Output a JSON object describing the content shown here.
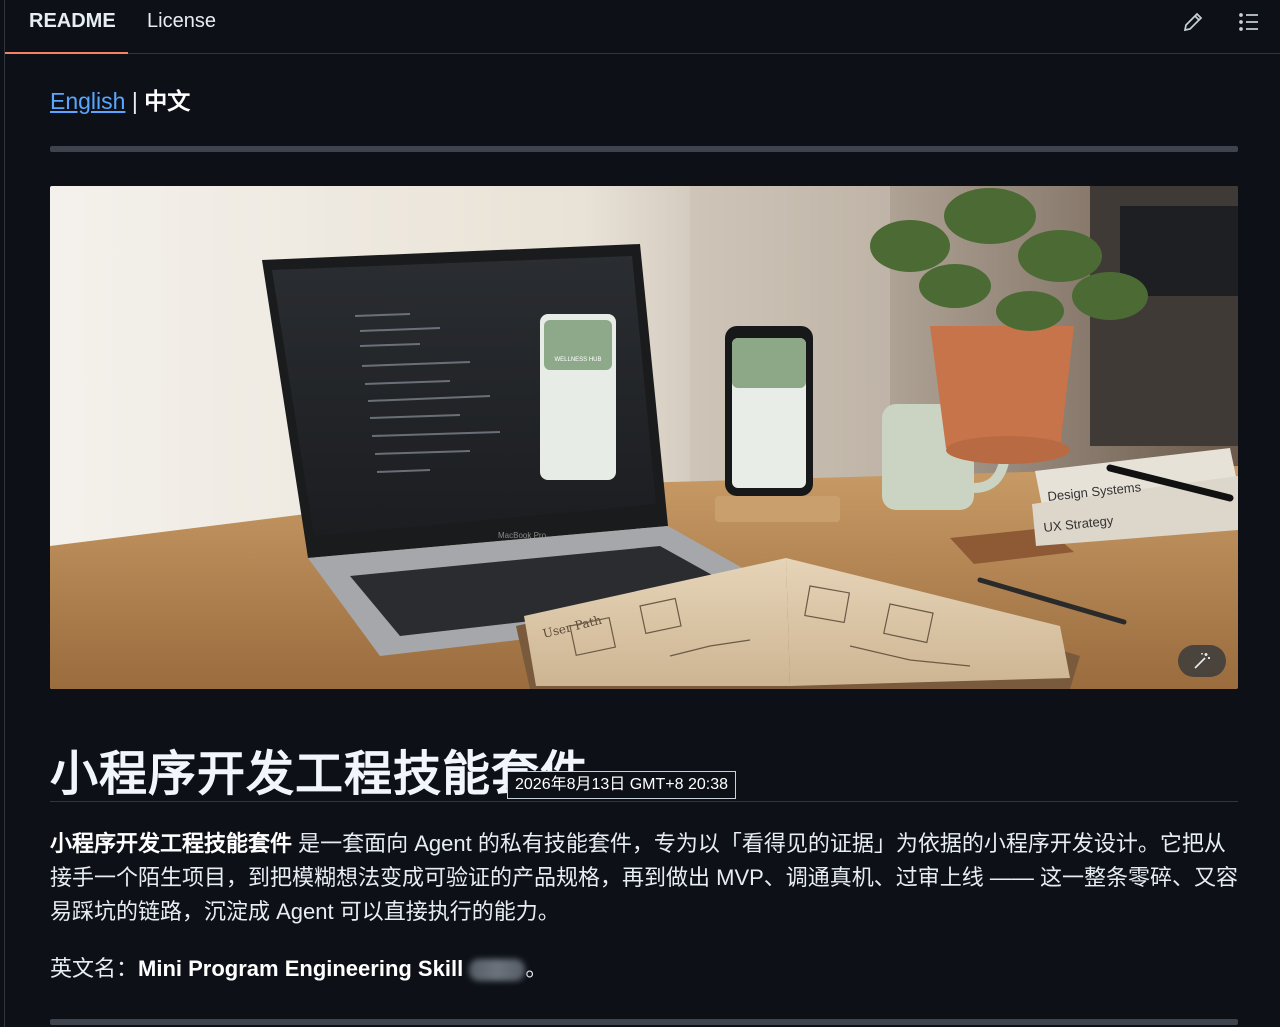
{
  "tabs": [
    {
      "label": "README",
      "active": true
    },
    {
      "label": "License",
      "active": false
    }
  ],
  "toolbar": {
    "edit_icon": "pencil-icon",
    "outline_icon": "list-outline-icon"
  },
  "language": {
    "english": "English",
    "separator": "|",
    "chinese": "中文"
  },
  "hero": {
    "alt_icon": "magic-wand-icon",
    "laptop_brand": "MacBook Pro",
    "app_screen_title": "WELLNESS HUB",
    "book_titles": [
      "Design Systems",
      "UX Strategy"
    ],
    "notebook_heading": "User Path"
  },
  "heading": {
    "title": "小程序开发工程技能套件"
  },
  "timestamp": "2026年8月13日 GMT+8 20:38",
  "intro": {
    "bold": "小程序开发工程技能套件",
    "text": " 是一套面向 Agent 的私有技能套件，专为以「看得见的证据」为依据的小程序开发设计。它把从接手一个陌生项目，到把模糊想法变成可验证的产品规格，再到做出 MVP、调通真机、过审上线 —— 这一整条零碎、又容易踩坑的链路，沉淀成 Agent 可以直接执行的能力。"
  },
  "english_name": {
    "label": "英文名：",
    "value": "Mini Program Engineering Skill",
    "end": "。"
  },
  "colors": {
    "background": "#0d1117",
    "link": "#58a6ff",
    "active_tab_underline": "#f78166"
  }
}
